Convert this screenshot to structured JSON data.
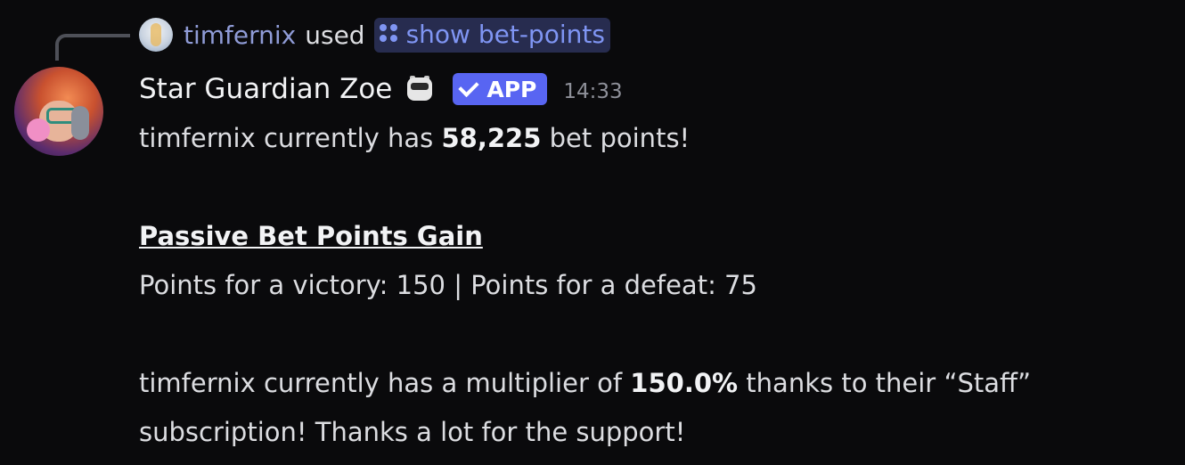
{
  "reply": {
    "user": "timfernix",
    "used": "used",
    "command": "show bet-points",
    "avatar_icon": "user-avatar-icon",
    "command_icon": "slash-command-icon"
  },
  "message": {
    "username": "Star Guardian Zoe",
    "bot_emoji_icon": "robot-emoji-icon",
    "app_badge": "APP",
    "timestamp": "14:33",
    "line1_pre": "timfernix currently has ",
    "line1_bold": "58,225",
    "line1_post": " bet points!",
    "heading": "Passive Bet Points Gain",
    "points_line": "Points for a victory: 150 | Points for a defeat: 75",
    "multiplier_pre": "timfernix currently has a multiplier of ",
    "multiplier_bold": "150.0%",
    "multiplier_post": " thanks to their “Staff” subscription! Thanks a lot for the support!"
  },
  "colors": {
    "background": "#0a0a0c",
    "accent": "#5865f2",
    "command_text": "#7f95f3",
    "reply_user": "#8f9bd6"
  }
}
